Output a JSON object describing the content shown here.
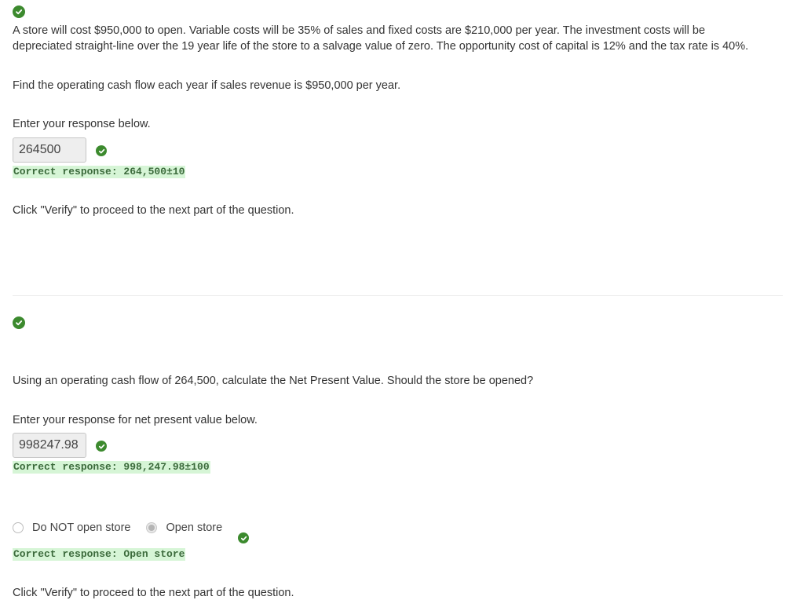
{
  "part1": {
    "problem_text": "A store will cost $950,000 to open. Variable costs will be 35% of sales and fixed costs are $210,000 per year. The investment costs will be depreciated straight-line over the 19 year life of the store to a salvage value of zero. The opportunity cost of capital is 12% and the tax rate is 40%.",
    "question": "Find the operating cash flow each year if sales revenue is $950,000 per year.",
    "prompt": "Enter your response below.",
    "answer_value": "264500",
    "correct_response": "Correct response: 264,500±10",
    "instruction": "Click \"Verify\" to proceed to the next part of the question."
  },
  "part2": {
    "question": "Using an operating cash flow of 264,500, calculate the Net Present Value. Should the store be opened?",
    "prompt": "Enter your response for net present value below.",
    "answer_value": "998247.98",
    "correct_response": "Correct response: 998,247.98±100",
    "options": [
      {
        "label": "Do NOT open store",
        "selected": false
      },
      {
        "label": "Open store",
        "selected": true
      }
    ],
    "choice_correct_response": "Correct response: Open store",
    "instruction": "Click \"Verify\" to proceed to the next part of the question."
  },
  "colors": {
    "check_green": "#3c8a2e",
    "correct_bg": "#d6f5d6",
    "correct_text": "#3b6a3b"
  },
  "icons": {
    "status": "check-circle-icon",
    "radio": "radio-button-icon"
  }
}
